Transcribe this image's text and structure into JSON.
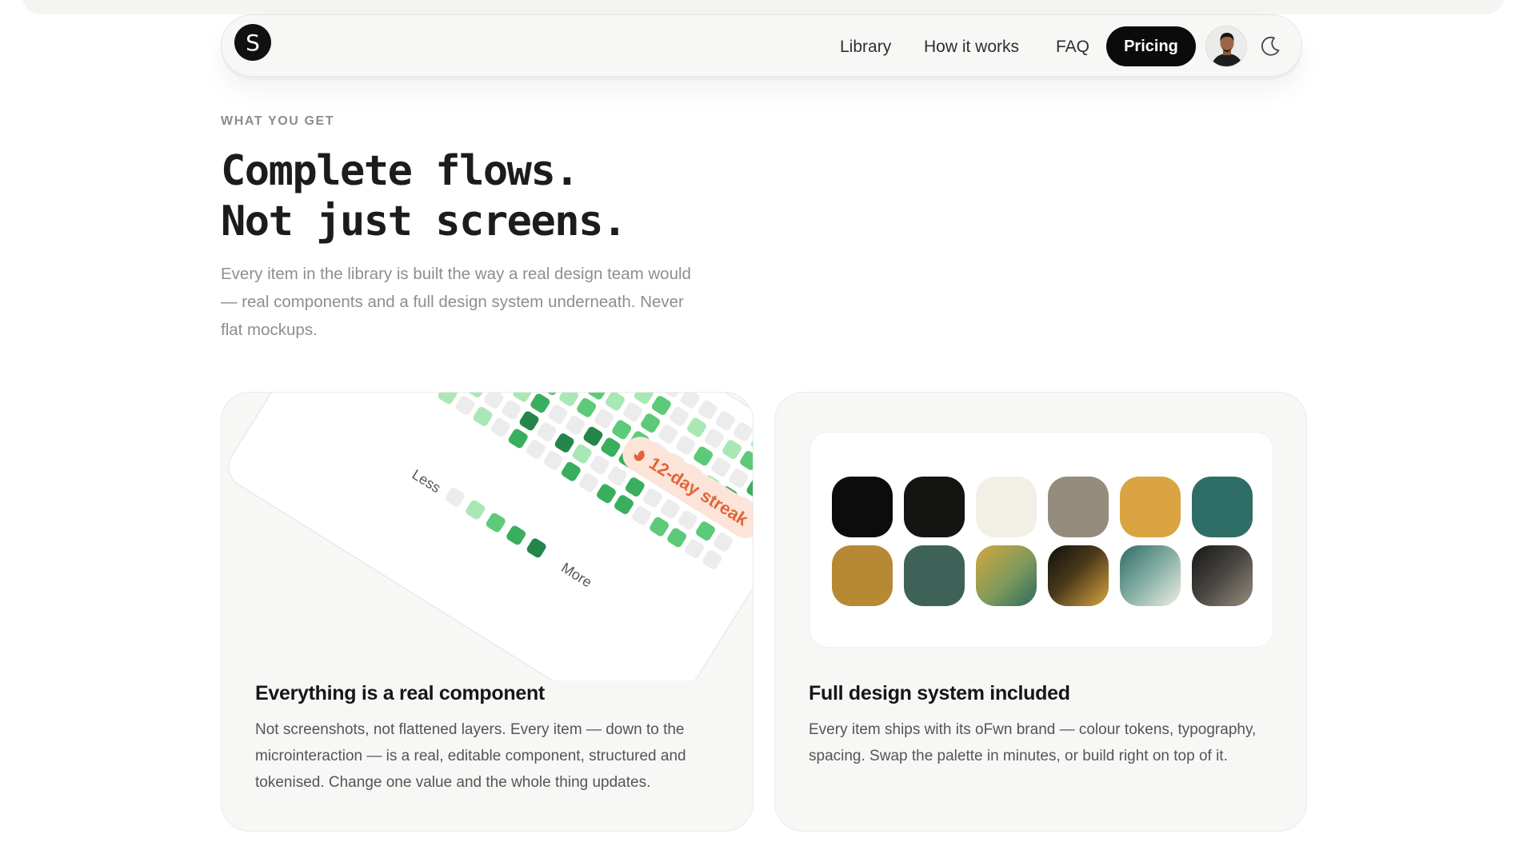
{
  "nav": {
    "logo_letter": "S",
    "links": [
      "Library",
      "How it works",
      "FAQ"
    ],
    "cta_label": "Pricing",
    "icons": {
      "avatar": "user-avatar",
      "theme": "moon-icon"
    }
  },
  "hero": {
    "eyebrow": "WHAT YOU GET",
    "headline_line1": "Complete flows.",
    "headline_line2": "Not just screens.",
    "lead": "Every item in the library is built the way a real design team would — real components and a full design system underneath. Never flat mockups."
  },
  "cards": [
    {
      "title": "Everything is a real component",
      "text": "Not screenshots, not flattened layers. Every item — down to the microinteraction — is a real, editable component, structured and tokenised. Change one value and the whole thing updates.",
      "illustration": {
        "streak_label": "12-day streak",
        "legend_less": "Less",
        "legend_more": "More",
        "icons": {
          "streak": "flame-icon"
        }
      }
    },
    {
      "title": "Full design system included",
      "text": "Every item ships with its oFwn brand — colour tokens, typography, spacing. Swap the palette in minutes, or build right on top of it.",
      "palette": [
        "#0c0c0c",
        "#141413",
        "#f2efe6",
        "#958c7d",
        "#d9a441",
        "#2f6e66",
        "#b88935",
        "#3f6258",
        "gradient-olive-teal",
        "gradient-black-gold",
        "gradient-teal-cream",
        "gradient-charcoal-stone"
      ]
    }
  ],
  "colors": {
    "heat_levels": [
      "#ececec",
      "#a9e8b4",
      "#5cca78",
      "#39ae5d",
      "#23854a"
    ],
    "streak_bg": "#fde4d8",
    "streak_text": "#e2643a"
  }
}
